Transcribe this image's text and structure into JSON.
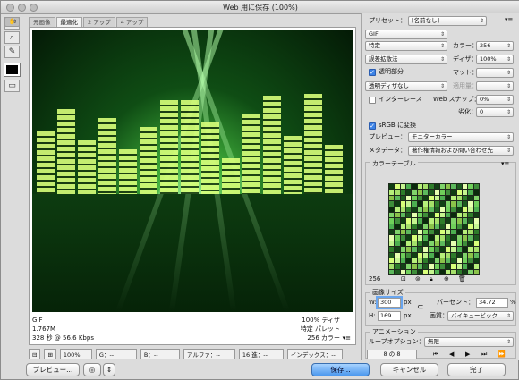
{
  "window": {
    "title": "Web 用に保存 (100%)"
  },
  "tabs": [
    "元画像",
    "最適化",
    "2 アップ",
    "4 アップ"
  ],
  "image_info": {
    "left": [
      "GIF",
      "1.767M",
      "328 秒 @ 56.6 Kbps"
    ],
    "right": [
      "100% ディザ",
      "特定 パレット",
      "256 カラー"
    ]
  },
  "status_bar": {
    "zoom": "100%",
    "g": "G：--",
    "b": "B：--",
    "alpha": "アルファ：--",
    "hex": "16 進：--",
    "index": "インデックス：--"
  },
  "buttons": {
    "preview": "プレビュー...",
    "save": "保存...",
    "cancel": "キャンセル",
    "done": "完了"
  },
  "preset": {
    "label": "プリセット：",
    "value": "[名前なし]"
  },
  "format": "GIF",
  "settings": {
    "reduction": "特定",
    "colors_label": "カラー：",
    "colors": "256",
    "dither_algo": "誤差拡散法",
    "dither_label": "ディザ：",
    "dither": "100%",
    "transparency_label": "透明部分",
    "matte_label": "マット：",
    "transparency_dither": "透明ディザなし",
    "amount_label": "適用量：",
    "interlaced_label": "インターレース",
    "websnap_label": "Web スナップ：",
    "websnap": "0%",
    "lossy_label": "劣化：",
    "lossy": "0",
    "srgb_label": "sRGB に変換",
    "preview_label": "プレビュー：",
    "preview_value": "モニターカラー",
    "metadata_label": "メタデータ：",
    "metadata_value": "著作権情報および問い合わせ先"
  },
  "color_table": {
    "title": "カラーテーブル",
    "count": "256"
  },
  "image_size": {
    "title": "画像サイズ",
    "w_label": "W:",
    "w": "300",
    "h_label": "H:",
    "h": "169",
    "unit": "px",
    "percent_label": "パーセント：",
    "percent": "34.72",
    "percent_unit": "%",
    "quality_label": "画質：",
    "quality": "バイキュービック..."
  },
  "animation": {
    "title": "アニメーション",
    "loop_label": "ループオプション：",
    "loop": "無限",
    "frame": "8 の 8"
  }
}
